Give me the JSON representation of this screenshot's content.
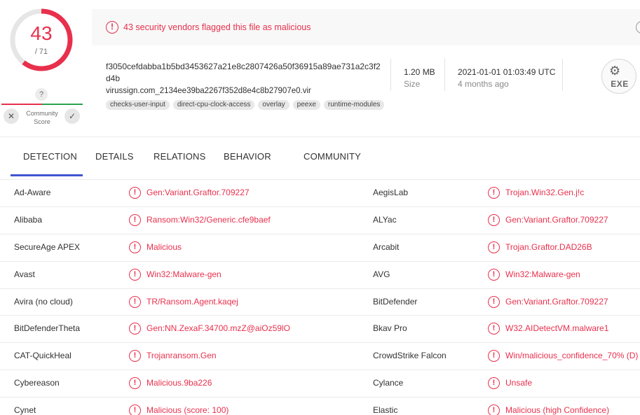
{
  "score": {
    "detected": "43",
    "total": "/ 71",
    "fraction": 0.6056,
    "ring_color": "#e8304d"
  },
  "community": {
    "unknown_glyph": "?",
    "label": "Community Score",
    "down_glyph": "✕",
    "up_glyph": "✓"
  },
  "alert": {
    "text": "43 security vendors flagged this file as malicious",
    "icon_glyph": "!",
    "color": "#e8304d"
  },
  "file": {
    "hash": "f3050cefdabba1b5bd3453627a21e8c2807426a50f36915a89ae731a2c3f2d4b",
    "name": "virussign.com_2134ee39ba2267f352d8e4c8b27907e0.vir",
    "tags": [
      "checks-user-input",
      "direct-cpu-clock-access",
      "overlay",
      "peexe",
      "runtime-modules"
    ],
    "size": "1.20 MB",
    "size_label": "Size",
    "date": "2021-01-01 01:03:49 UTC",
    "date_ago": "4 months ago",
    "type_icon": "exe-file-icon",
    "type_label": "EXE"
  },
  "tabs": [
    {
      "label": "DETECTION",
      "active": true
    },
    {
      "label": "DETAILS"
    },
    {
      "label": "RELATIONS"
    },
    {
      "label": "BEHAVIOR"
    },
    {
      "label": "COMMUNITY"
    }
  ],
  "detections": [
    {
      "v1": "Ad-Aware",
      "r1": "Gen:Variant.Graftor.709227",
      "v2": "AegisLab",
      "r2": "Trojan.Win32.Gen.j!c"
    },
    {
      "v1": "Alibaba",
      "r1": "Ransom:Win32/Generic.cfe9baef",
      "v2": "ALYac",
      "r2": "Gen:Variant.Graftor.709227"
    },
    {
      "v1": "SecureAge APEX",
      "r1": "Malicious",
      "v2": "Arcabit",
      "r2": "Trojan.Graftor.DAD26B"
    },
    {
      "v1": "Avast",
      "r1": "Win32:Malware-gen",
      "v2": "AVG",
      "r2": "Win32:Malware-gen"
    },
    {
      "v1": "Avira (no cloud)",
      "r1": "TR/Ransom.Agent.kaqej",
      "v2": "BitDefender",
      "r2": "Gen:Variant.Graftor.709227"
    },
    {
      "v1": "BitDefenderTheta",
      "r1": "Gen:NN.ZexaF.34700.mzZ@aiOz59lO",
      "v2": "Bkav Pro",
      "r2": "W32.AIDetectVM.malware1"
    },
    {
      "v1": "CAT-QuickHeal",
      "r1": "Trojanransom.Gen",
      "v2": "CrowdStrike Falcon",
      "r2": "Win/malicious_confidence_70% (D)"
    },
    {
      "v1": "Cybereason",
      "r1": "Malicious.9ba226",
      "v2": "Cylance",
      "r2": "Unsafe"
    },
    {
      "v1": "Cynet",
      "r1": "Malicious (score: 100)",
      "v2": "Elastic",
      "r2": "Malicious (high Confidence)"
    }
  ]
}
